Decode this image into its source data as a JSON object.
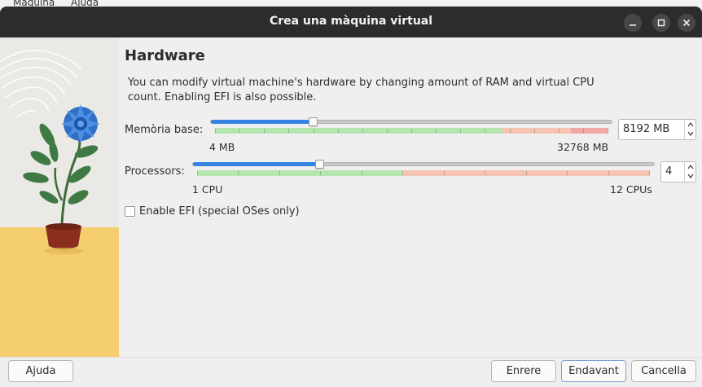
{
  "background_menu": {
    "items": [
      "Màquina",
      "Ajuda"
    ]
  },
  "window": {
    "title": "Crea una màquina virtual"
  },
  "page": {
    "heading": "Hardware",
    "description": "You can modify virtual machine's hardware by changing amount of RAM and virtual CPU count. Enabling EFI is also possible."
  },
  "memory": {
    "label": "Memòria base:",
    "value": "8192 MB",
    "value_mb": 8192,
    "min_label": "4 MB",
    "max_label": "32768 MB"
  },
  "processors": {
    "label": "Processors:",
    "value": "4",
    "min_label": "1 CPU",
    "max_label": "12 CPUs"
  },
  "efi": {
    "label": "Enable EFI (special OSes only)",
    "checked": false
  },
  "buttons": {
    "help": "Ajuda",
    "back": "Enrere",
    "next": "Endavant",
    "cancel": "Cancella"
  },
  "colors": {
    "accent": "#3584e4",
    "safe_zone": "#b5e6b0",
    "warning_zone": "#f5c4b0",
    "danger_zone": "#f0a8a8",
    "titlebar": "#2c2c2c"
  },
  "icons": [
    "minimize-icon",
    "maximize-icon",
    "close-icon",
    "spin-up-icon",
    "spin-down-icon"
  ]
}
